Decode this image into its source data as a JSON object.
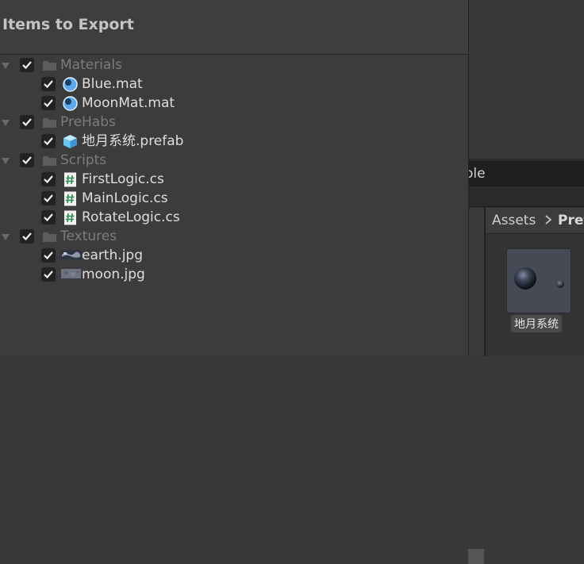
{
  "dialog": {
    "title": "Items to Export",
    "tree": [
      {
        "type": "folder",
        "label": "Materials",
        "checked": true,
        "icon": "folder-icon",
        "children": [
          {
            "label": "Blue.mat",
            "checked": true,
            "icon": "material-sphere-icon"
          },
          {
            "label": "MoonMat.mat",
            "checked": true,
            "icon": "material-sphere-icon"
          }
        ]
      },
      {
        "type": "folder",
        "label": "PreHabs",
        "checked": true,
        "icon": "folder-icon",
        "children": [
          {
            "label": "地月系统.prefab",
            "checked": true,
            "icon": "prefab-cube-icon"
          }
        ]
      },
      {
        "type": "folder",
        "label": "Scripts",
        "checked": true,
        "icon": "folder-icon",
        "children": [
          {
            "label": "FirstLogic.cs",
            "checked": true,
            "icon": "csharp-script-icon"
          },
          {
            "label": "MainLogic.cs",
            "checked": true,
            "icon": "csharp-script-icon"
          },
          {
            "label": "RotateLogic.cs",
            "checked": true,
            "icon": "csharp-script-icon"
          }
        ]
      },
      {
        "type": "folder",
        "label": "Textures",
        "checked": true,
        "icon": "folder-icon",
        "children": [
          {
            "label": "earth.jpg",
            "checked": true,
            "icon": "texture-thumbnail-icon"
          },
          {
            "label": "moon.jpg",
            "checked": true,
            "icon": "texture-thumbnail-icon"
          }
        ]
      }
    ]
  },
  "project_panel": {
    "search_text_fragment": "ole",
    "breadcrumb": {
      "root": "Assets",
      "current": "Prefa"
    },
    "asset": {
      "label": "地月系统",
      "icon": "prefab-preview-icon"
    }
  },
  "colors": {
    "dialog_bg": "#3c3c3c",
    "text": "#dedede",
    "folder_text": "#7c7c7c",
    "checkbox_bg": "#222222",
    "material_blue": "#5aa8f0",
    "prefab_blue": "#6ec6f5",
    "script_green": "#2a8a4a"
  }
}
